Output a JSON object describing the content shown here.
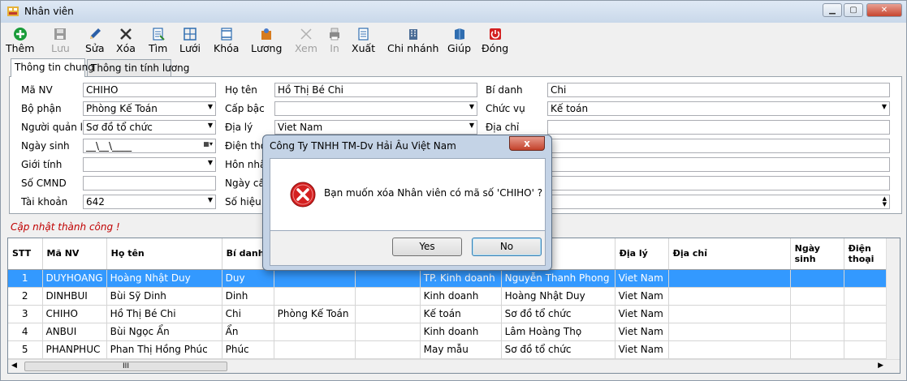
{
  "window": {
    "title": "Nhân viên",
    "min_icon": "minimize-icon",
    "max_icon": "maximize-icon",
    "close_icon": "close-icon"
  },
  "toolbar": {
    "items": [
      {
        "label": "Thêm",
        "icon": "add-icon",
        "enabled": true,
        "color": "#1a9c3a"
      },
      {
        "label": "Lưu",
        "icon": "save-icon",
        "enabled": false,
        "color": "#9a9a9a"
      },
      {
        "label": "Sửa",
        "icon": "edit-icon",
        "enabled": true,
        "color": "#2b5fa6"
      },
      {
        "label": "Xóa",
        "icon": "delete-icon",
        "enabled": true,
        "color": "#333333"
      },
      {
        "label": "Tìm",
        "icon": "find-icon",
        "enabled": true,
        "color": "#2f6db0"
      },
      {
        "label": "Lưới",
        "icon": "grid-icon",
        "enabled": true,
        "color": "#2f6db0"
      },
      {
        "label": "Khóa",
        "icon": "lock-icon",
        "enabled": true,
        "color": "#2f6db0"
      },
      {
        "label": "Lương",
        "icon": "salary-icon",
        "enabled": true,
        "color": "#d77b1f"
      },
      {
        "label": "Xem",
        "icon": "view-icon",
        "enabled": false,
        "color": "#b0b0b0"
      },
      {
        "label": "In",
        "icon": "print-icon",
        "enabled": false,
        "color": "#8a8a8a"
      },
      {
        "label": "Xuất",
        "icon": "export-icon",
        "enabled": true,
        "color": "#2f6db0"
      },
      {
        "label": "Chi nhánh",
        "icon": "branch-icon",
        "enabled": true,
        "color": "#4b6c95"
      },
      {
        "label": "Giúp",
        "icon": "help-icon",
        "enabled": true,
        "color": "#2f6db0"
      },
      {
        "label": "Đóng",
        "icon": "power-icon",
        "enabled": true,
        "color": "#d32020"
      }
    ]
  },
  "tabs": [
    {
      "label": "Thông tin chung",
      "active": true
    },
    {
      "label": "Thông tin tính lương",
      "active": false
    }
  ],
  "form": {
    "ma_nv": {
      "label": "Mã NV",
      "value": "CHIHO"
    },
    "bo_phan": {
      "label": "Bộ phận",
      "value": "Phòng Kế Toán"
    },
    "nguoi_quan_ly": {
      "label": "Người quản lý",
      "value": "Sơ đồ tổ chức"
    },
    "ngay_sinh": {
      "label": "Ngày sinh",
      "value": "__\\__\\____"
    },
    "gioi_tinh": {
      "label": "Giới tính",
      "value": ""
    },
    "so_cmnd": {
      "label": "Số CMND",
      "value": ""
    },
    "tai_khoan": {
      "label": "Tài khoản",
      "value": "642"
    },
    "ho_ten": {
      "label": "Họ tên",
      "value": "Hồ Thị Bé Chi"
    },
    "cap_bac": {
      "label": "Cấp bậc",
      "value": ""
    },
    "dia_ly": {
      "label": "Địa lý",
      "value": "Viet Nam"
    },
    "dien_thoai": {
      "label": "Điện thoạ",
      "value": ""
    },
    "hon_nhan": {
      "label": "Hôn nhân",
      "value": ""
    },
    "ngay_cap": {
      "label": "Ngày cấp",
      "value": ""
    },
    "so_hieu": {
      "label": "Số hiệu T",
      "value": ""
    },
    "bi_danh": {
      "label": "Bí danh",
      "value": "Chi"
    },
    "chuc_vu": {
      "label": "Chức vụ",
      "value": "Kế toán"
    },
    "dia_chi": {
      "label": "Địa chỉ",
      "value": ""
    }
  },
  "status_message": "Cập nhật thành công !",
  "grid": {
    "columns": [
      "STT",
      "Mã NV",
      "Họ tên",
      "Bí danh",
      "",
      "",
      "",
      "",
      "Địa lý",
      "Địa chỉ",
      "Ngày sinh",
      "Điện thoại"
    ],
    "rows": [
      [
        "1",
        "DUYHOANG",
        "Hoàng Nhật Duy",
        "Duy",
        "",
        "",
        "TP. Kinh doanh",
        "Nguyễn Thanh Phong",
        "Viet Nam",
        "",
        "",
        ""
      ],
      [
        "2",
        "DINHBUI",
        "Bùi Sỹ Dinh",
        "Dinh",
        "",
        "",
        "Kinh doanh",
        "Hoàng Nhật Duy",
        "Viet Nam",
        "",
        "",
        ""
      ],
      [
        "3",
        "CHIHO",
        "Hồ Thị Bé Chi",
        "Chi",
        "Phòng Kế Toán",
        "",
        "Kế toán",
        "Sơ đồ tổ chức",
        "Viet Nam",
        "",
        "",
        ""
      ],
      [
        "4",
        "ANBUI",
        "Bùi Ngọc Ẩn",
        "Ẩn",
        "",
        "",
        "Kinh doanh",
        "Lâm Hoàng Thọ",
        "Viet Nam",
        "",
        "",
        ""
      ],
      [
        "5",
        "PHANPHUC",
        "Phan Thị Hồng Phúc",
        "Phúc",
        "",
        "",
        "May mẫu",
        "Sơ đồ tổ chức",
        "Viet Nam",
        "",
        "",
        ""
      ]
    ],
    "selected_row": 0,
    "hscroll_glyph": "III"
  },
  "dialog": {
    "title": "Công Ty TNHH TM-Dv Hải Âu Việt Nam",
    "message": "Bạn muốn xóa Nhân viên có mã số 'CHIHO' ?",
    "icon": "error-icon",
    "yes_label": "Yes",
    "no_label": "No",
    "close_glyph": "x"
  }
}
